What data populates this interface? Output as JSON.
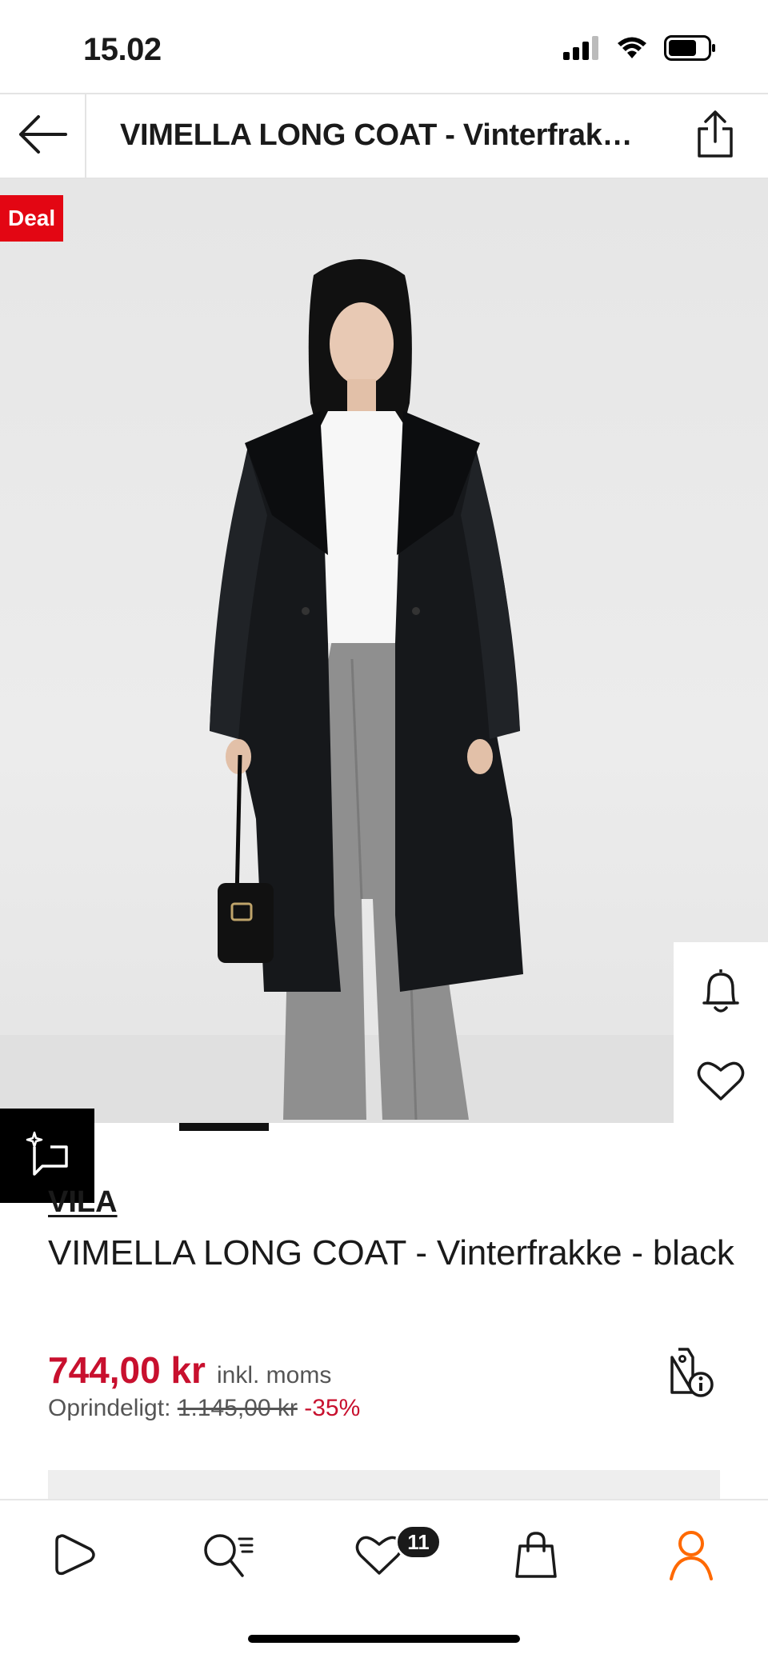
{
  "status_bar": {
    "time": "15.02",
    "icons": [
      "signal-icon",
      "wifi-icon",
      "battery-icon"
    ]
  },
  "header": {
    "title": "VIMELLA LONG COAT - Vinterfrakke - black",
    "back_icon": "arrow-left-icon",
    "share_icon": "share-icon"
  },
  "gallery": {
    "badge": "Deal",
    "badge_color": "#e30613",
    "actions": [
      "bell-icon",
      "heart-icon"
    ],
    "ai_icon": "sparkle-comment-icon"
  },
  "product": {
    "brand": "VILA",
    "name": "VIMELLA LONG COAT - Vinterfrakke - black",
    "price": "744,00 kr",
    "vat_note": "inkl. moms",
    "original_label": "Oprindeligt:",
    "original_price": "1.145,00 kr",
    "discount": "-35%",
    "price_color": "#c8102e"
  },
  "bottom_nav": {
    "items": [
      "home-icon",
      "search-icon",
      "wishlist-icon",
      "bag-icon",
      "profile-icon"
    ],
    "wishlist_count": "11",
    "active": "profile-icon",
    "accent_color": "#ff6900"
  }
}
